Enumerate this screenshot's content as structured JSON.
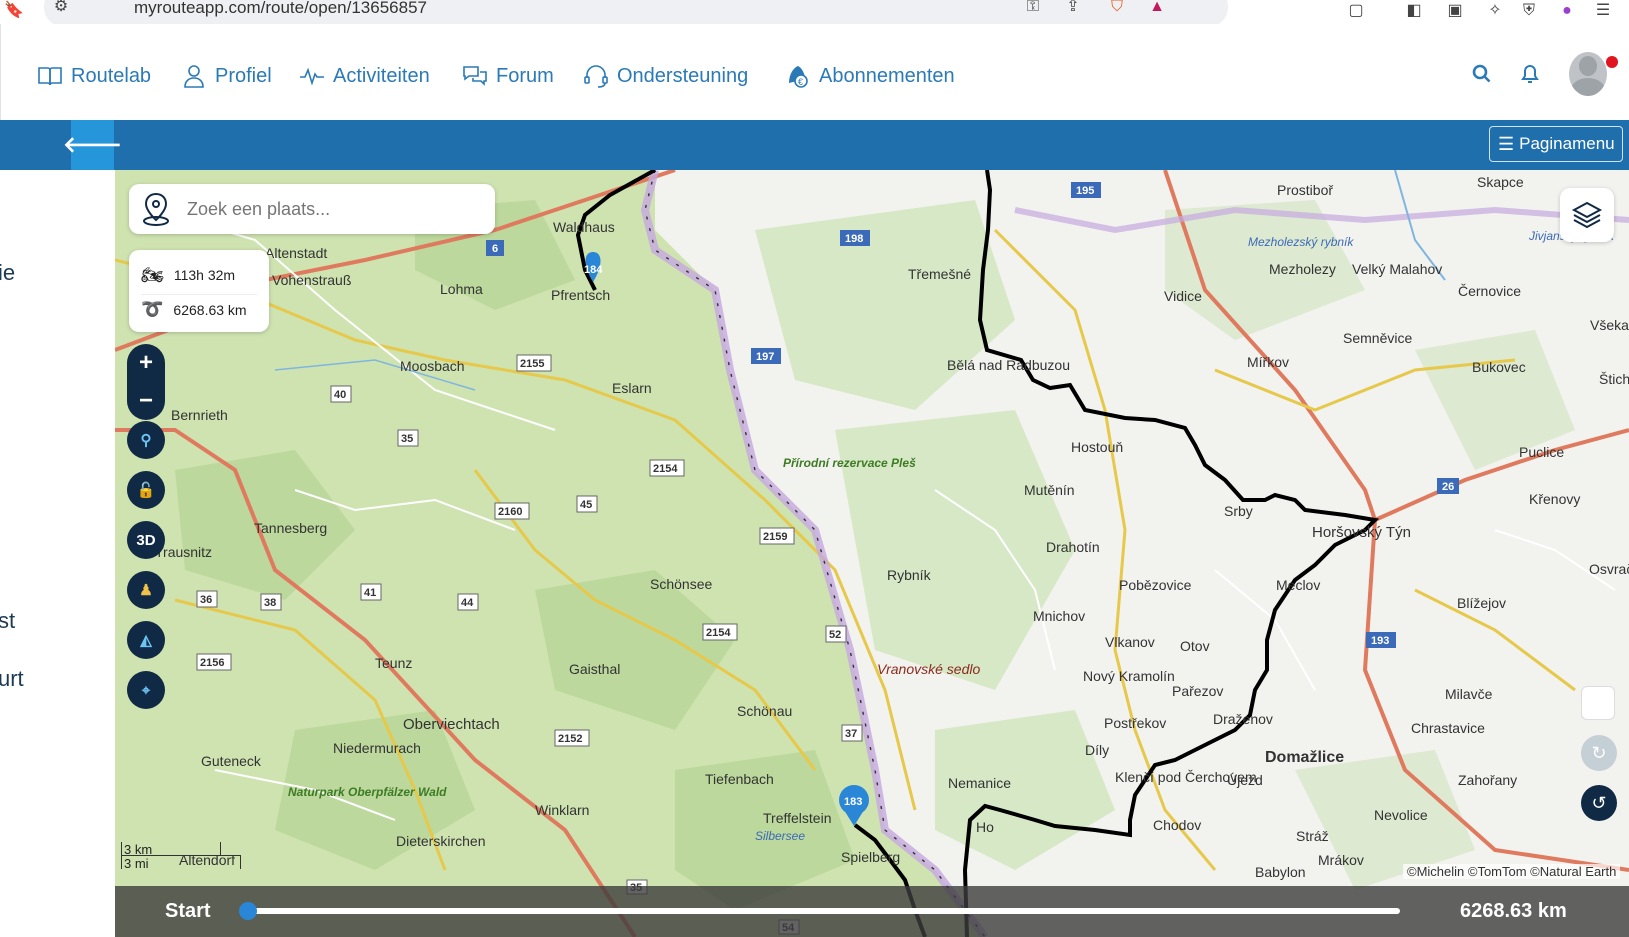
{
  "browser": {
    "url": "myrouteapp.com/route/open/13656857"
  },
  "nav": {
    "items": [
      "Routelab",
      "Profiel",
      "Activiteiten",
      "Forum",
      "Ondersteuning",
      "Abonnementen"
    ]
  },
  "header": {
    "page_menu_label": "Paginamenu"
  },
  "sidebar": {
    "fragments": [
      "ie",
      "st",
      "urt"
    ]
  },
  "map": {
    "search_placeholder": "Zoek een plaats...",
    "duration": "113h 32m",
    "distance": "6268.63 km",
    "controls": [
      "+",
      "−",
      "3D"
    ],
    "attribution": "©Michelin ©TomTom ©Natural Earth",
    "scale_km": "3 km",
    "scale_mi": "3 mi",
    "markers": [
      "184",
      "183"
    ],
    "places": [
      "Waldhaus",
      "Pfrentsch",
      "Altenstadt",
      "Vohenstrauß",
      "Lohma",
      "Moosbach",
      "Eslarn",
      "Bernrieth",
      "Tannesberg",
      "Trausnitz",
      "Schönsee",
      "Teunz",
      "Gaisthal",
      "Oberviechtach",
      "Niedermurach",
      "Schönau",
      "Guteneck",
      "Tiefenbach",
      "Winklarn",
      "Dieterskirchen",
      "Treffelstein",
      "Spielberg",
      "Třemešné",
      "Bělá nad Radbuzou",
      "Hostouň",
      "Mutěnín",
      "Drahotín",
      "Rybník",
      "Pobězovice",
      "Mnichov",
      "Vlkanov",
      "Otov",
      "Nový Kramolín",
      "Pařezov",
      "Postřekov",
      "Díly",
      "Nemanice",
      "Klenčí pod Čerchovem",
      "Chodov",
      "Újezd",
      "Domažlice",
      "Srby",
      "Horšovský Týn",
      "Prostiboř",
      "Mezholezy",
      "Velký Malahov",
      "Vidice",
      "Mířkov",
      "Semněvice",
      "Černovice",
      "Bukovec",
      "Puclice",
      "Křenovy",
      "Blížejov",
      "Milavče",
      "Chrastavice",
      "Zahořany",
      "Meclov",
      "Draženov",
      "Skapce",
      "Všekary",
      "Štichov",
      "Osvračín",
      "Nevolice",
      "Mrákov",
      "Babylon",
      "Stráž",
      "Ho",
      "Altendorf",
      "Přírodní rezervace Pleš",
      "Vranovské sedlo",
      "Naturpark Oberpfälzer Wald",
      "Mezholezský rybník",
      "Jivjanský rybník",
      "Silbersee"
    ],
    "road_numbers": [
      "195",
      "198",
      "197",
      "6",
      "2155",
      "40",
      "35",
      "2154",
      "45",
      "2160",
      "2159",
      "36",
      "38",
      "41",
      "44",
      "2156",
      "2154",
      "52",
      "2152",
      "37",
      "193",
      "26",
      "35",
      "54"
    ]
  },
  "timeline": {
    "start_label": "Start",
    "end_label": "6268.63 km",
    "progress": 0.0
  }
}
